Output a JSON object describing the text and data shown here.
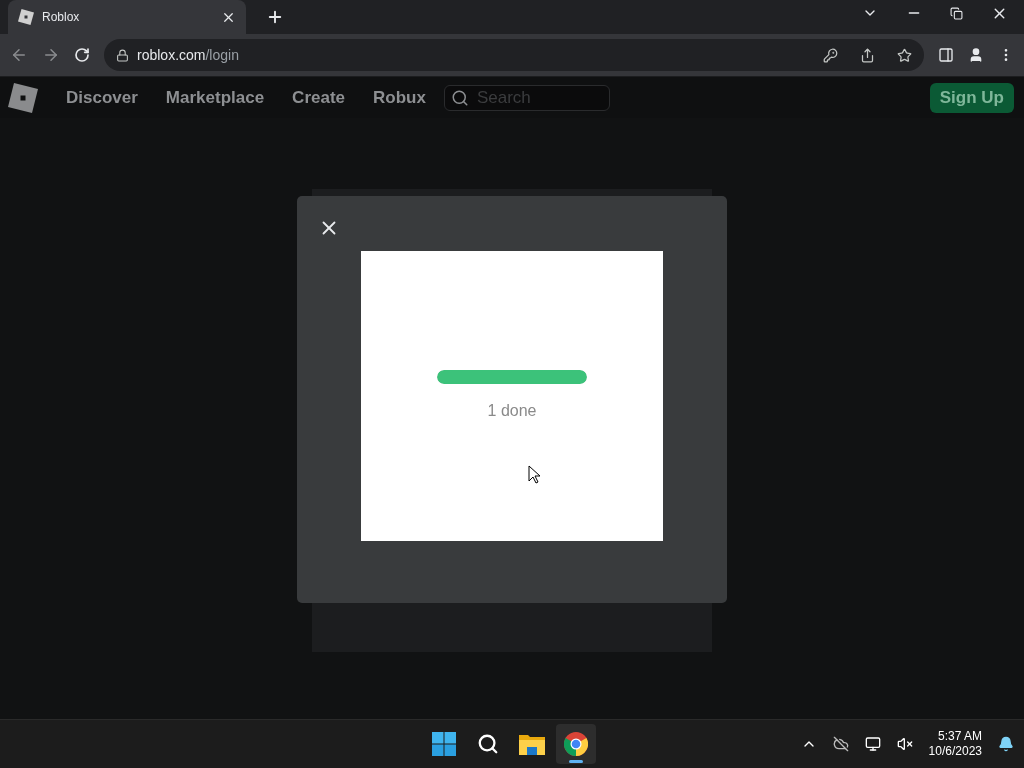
{
  "browser": {
    "tab": {
      "title": "Roblox"
    },
    "address": {
      "domain": "roblox.com",
      "path": "/login"
    }
  },
  "site_nav": {
    "items": [
      "Discover",
      "Marketplace",
      "Create",
      "Robux"
    ],
    "search": {
      "placeholder": "Search"
    },
    "signup_button": "Sign Up"
  },
  "modal": {
    "progress": {
      "level": 1,
      "label": "1 done"
    }
  },
  "taskbar": {
    "apps": [
      {
        "kind": "start",
        "selected": false
      },
      {
        "kind": "search",
        "selected": false
      },
      {
        "kind": "explorer",
        "selected": false
      },
      {
        "kind": "browser",
        "selected": true
      }
    ],
    "clock": {
      "time": "5:37 AM",
      "date": "10/6/2023"
    }
  }
}
